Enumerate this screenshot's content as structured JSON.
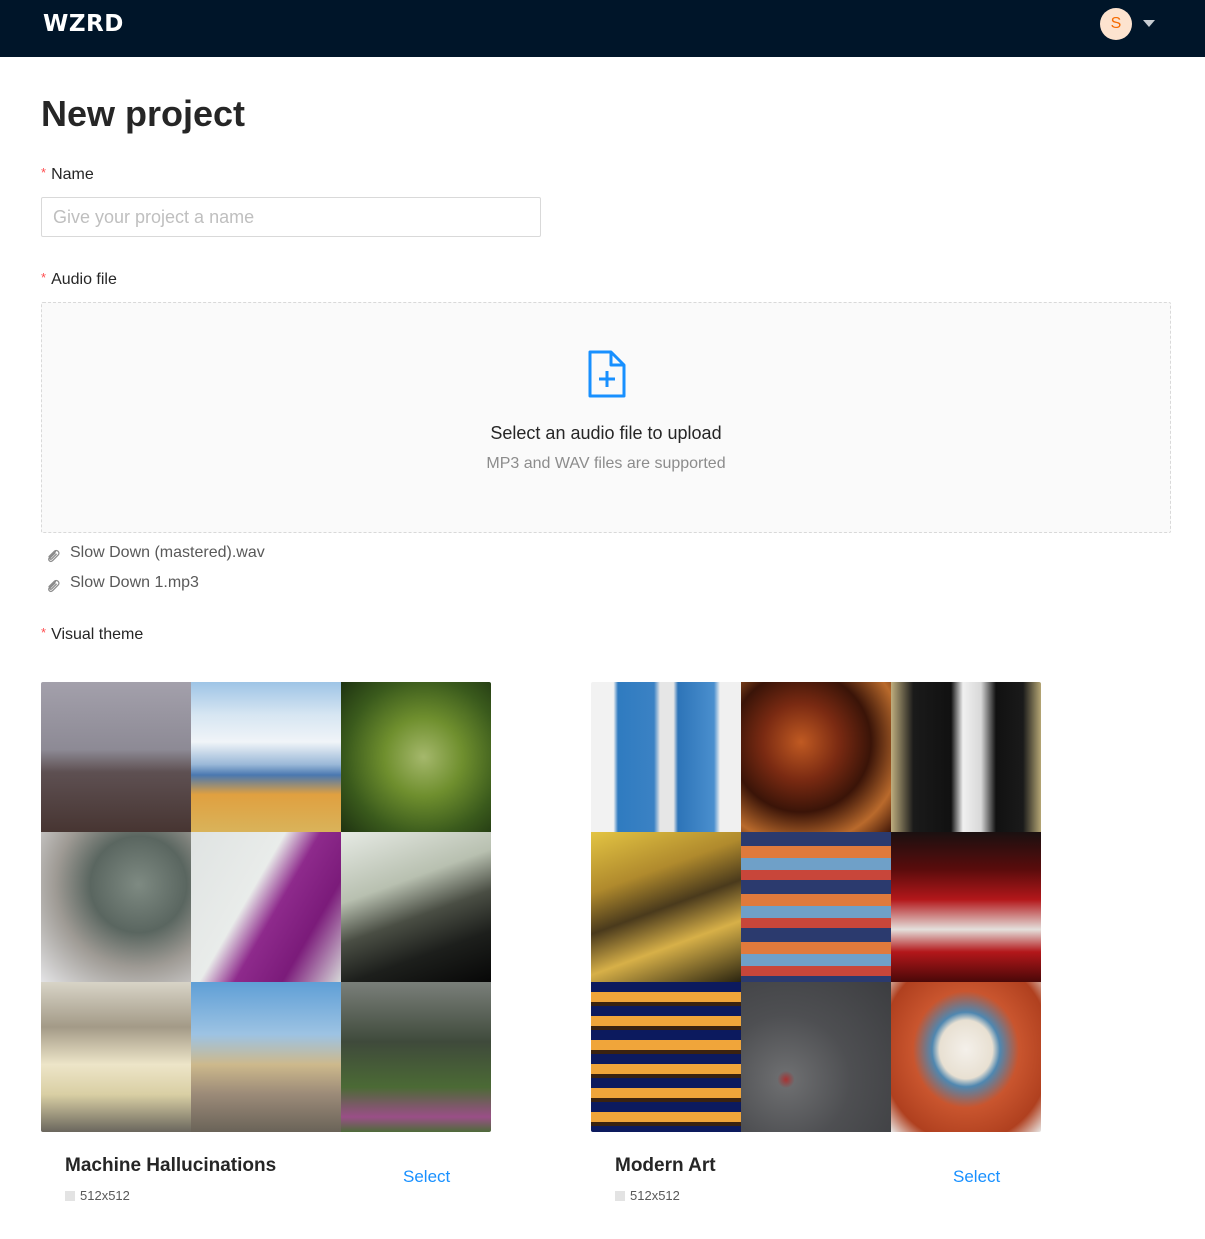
{
  "app": {
    "logo": "WZRD",
    "user_initial": "S"
  },
  "page": {
    "title": "New project"
  },
  "form": {
    "name": {
      "label": "Name",
      "required_mark": "*",
      "value": "",
      "placeholder": "Give your project a name"
    },
    "audio": {
      "label": "Audio file",
      "required_mark": "*",
      "upload_title": "Select an audio file to upload",
      "upload_hint": "MP3 and WAV files are supported",
      "files": [
        "Slow Down (mastered).wav",
        "Slow Down 1.mp3"
      ]
    },
    "theme": {
      "label": "Visual theme",
      "required_mark": "*",
      "options": [
        {
          "title": "Machine Hallucinations",
          "size": "512x512",
          "action": "Select",
          "thumbnails": [
            "pier-railing-photo",
            "white-bus-photo",
            "spiderweb-leaves-photo",
            "lizard-head-photo",
            "purple-sock-photo",
            "glossy-abstract-photo",
            "toy-shelves-photo",
            "city-tower-photo",
            "jungle-plants-photo"
          ]
        },
        {
          "title": "Modern Art",
          "size": "512x512",
          "action": "Select",
          "thumbnails": [
            "blue-panels-art",
            "brown-abstract-art",
            "black-white-figure-art",
            "yellow-landscape-art",
            "striped-color-art",
            "red-building-art",
            "orange-windows-art",
            "gray-red-art",
            "swirl-red-art"
          ]
        }
      ]
    }
  },
  "colors": {
    "header_bg": "#001529",
    "accent": "#1890ff",
    "required": "#ff4d4f",
    "avatar_bg": "#fde3cf",
    "avatar_text": "#f56a00"
  }
}
